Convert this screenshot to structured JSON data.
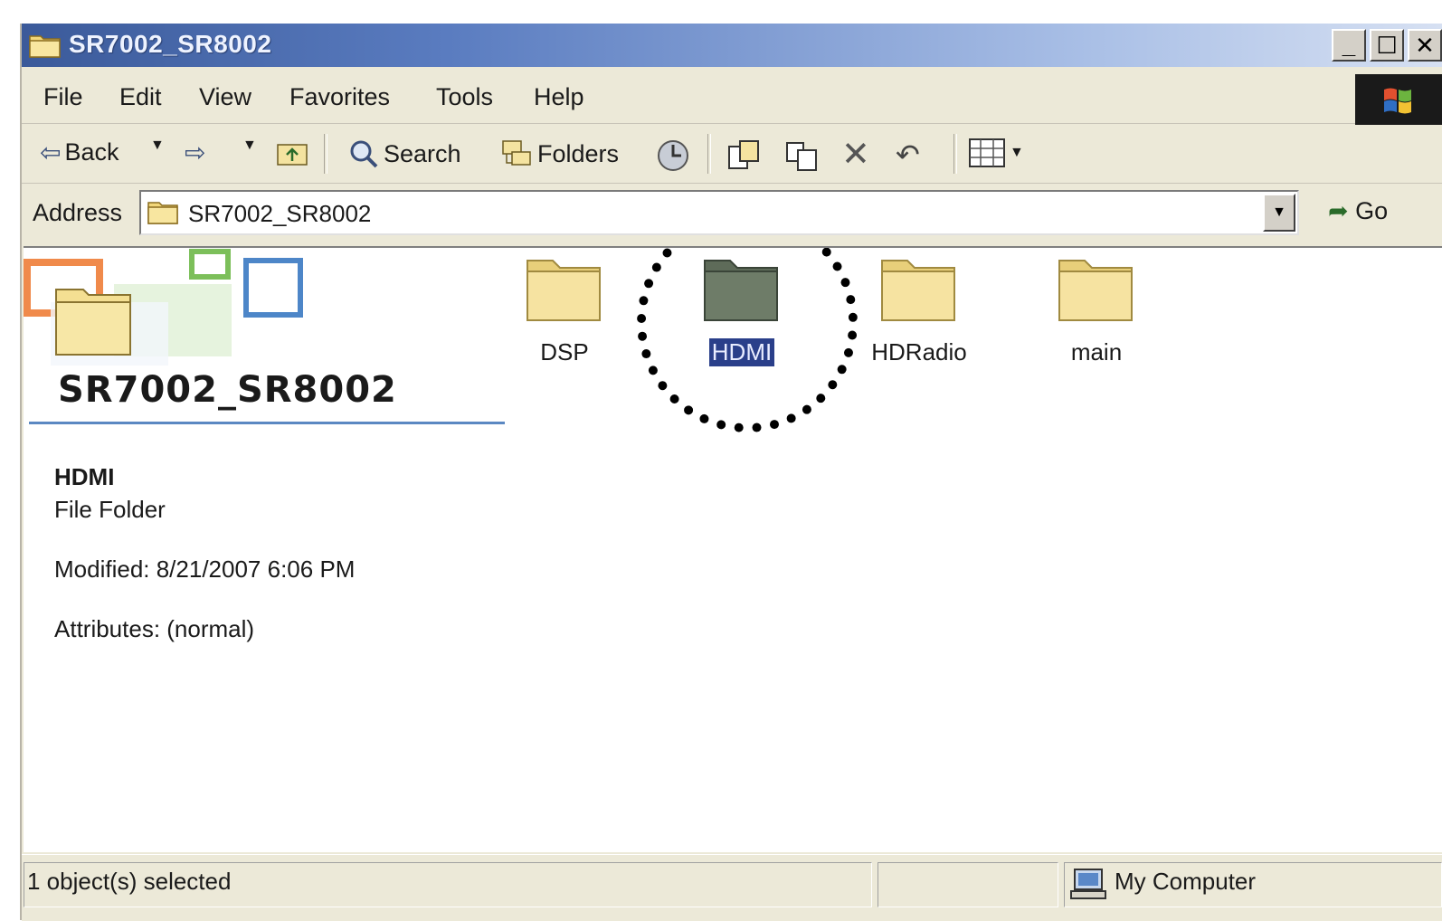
{
  "window": {
    "title": "SR7002_SR8002",
    "controls": [
      "_",
      "☐",
      "✕"
    ]
  },
  "menu": {
    "items": [
      {
        "label": "File"
      },
      {
        "label": "Edit"
      },
      {
        "label": "View"
      },
      {
        "label": "Favorites"
      },
      {
        "label": "Tools"
      },
      {
        "label": "Help"
      }
    ]
  },
  "toolbar": {
    "back_label": "Back",
    "search_label": "Search",
    "folders_label": "Folders"
  },
  "address": {
    "label": "Address",
    "value": "SR7002_SR8002",
    "go_label": "Go"
  },
  "content": {
    "folder_title": "SR7002_SR8002",
    "selected": {
      "name": "HDMI",
      "type": "File Folder",
      "modified": "Modified: 8/21/2007 6:06 PM",
      "attributes": "Attributes: (normal)"
    },
    "folders": [
      {
        "name": "DSP",
        "selected": false
      },
      {
        "name": "HDMI",
        "selected": true
      },
      {
        "name": "HDRadio",
        "selected": false
      },
      {
        "name": "main",
        "selected": false
      }
    ],
    "colors": {
      "folder_fill": "#f6e3a1",
      "selected_folder_fill": "#6e7c68",
      "selection_highlight": "#2a3f8a"
    }
  },
  "status": {
    "selection_text": "1 object(s) selected",
    "location_text": "My Computer"
  }
}
